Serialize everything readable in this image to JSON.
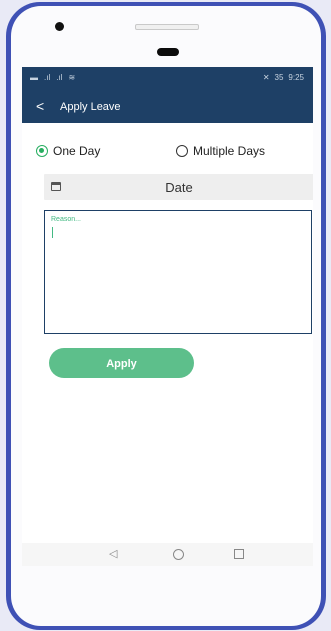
{
  "status_bar": {
    "left_icons": [
      "sim-icon",
      "signal-icon",
      "signal-icon",
      "wifi-icon"
    ],
    "battery": "35",
    "time": "9:25"
  },
  "app_bar": {
    "back_glyph": "<",
    "title": "Apply Leave"
  },
  "leave_type": {
    "options": [
      {
        "label": "One Day",
        "selected": true
      },
      {
        "label": "Multiple Days",
        "selected": false
      }
    ]
  },
  "date_field": {
    "label": "Date",
    "icon": "calendar-icon"
  },
  "reason": {
    "placeholder": "Reason..."
  },
  "apply_button": {
    "label": "Apply"
  },
  "nav_bar": {
    "icons": [
      "back-triangle-icon",
      "home-circle-icon",
      "recents-square-icon"
    ]
  },
  "colors": {
    "primary": "#1e4066",
    "accent_green": "#5dbf8b",
    "radio_green": "#27ae60",
    "frame_blue": "#3f51b5"
  }
}
